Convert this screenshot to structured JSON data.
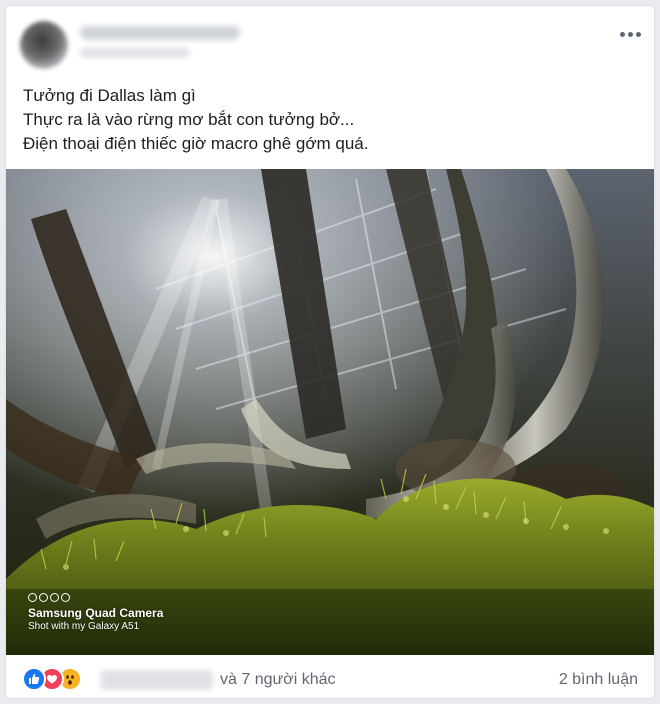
{
  "post": {
    "lines": [
      "Tưởng đi Dallas làm gì",
      "Thực ra là vào rừng mơ bắt con tưởng bở...",
      "Điện thoại điện thiếc giờ macro ghê gớm quá."
    ],
    "photo": {
      "watermark_title": "Samsung Quad Camera",
      "watermark_subtitle": "Shot with my Galaxy A51"
    }
  },
  "reactions": {
    "icons": [
      "like-icon",
      "love-icon",
      "wow-icon"
    ],
    "colors": {
      "like": "#1877f2",
      "love": "#f33e58",
      "wow": "#f7b125"
    },
    "others_text": "và 7 người khác",
    "comments_text": "2 bình luận"
  }
}
